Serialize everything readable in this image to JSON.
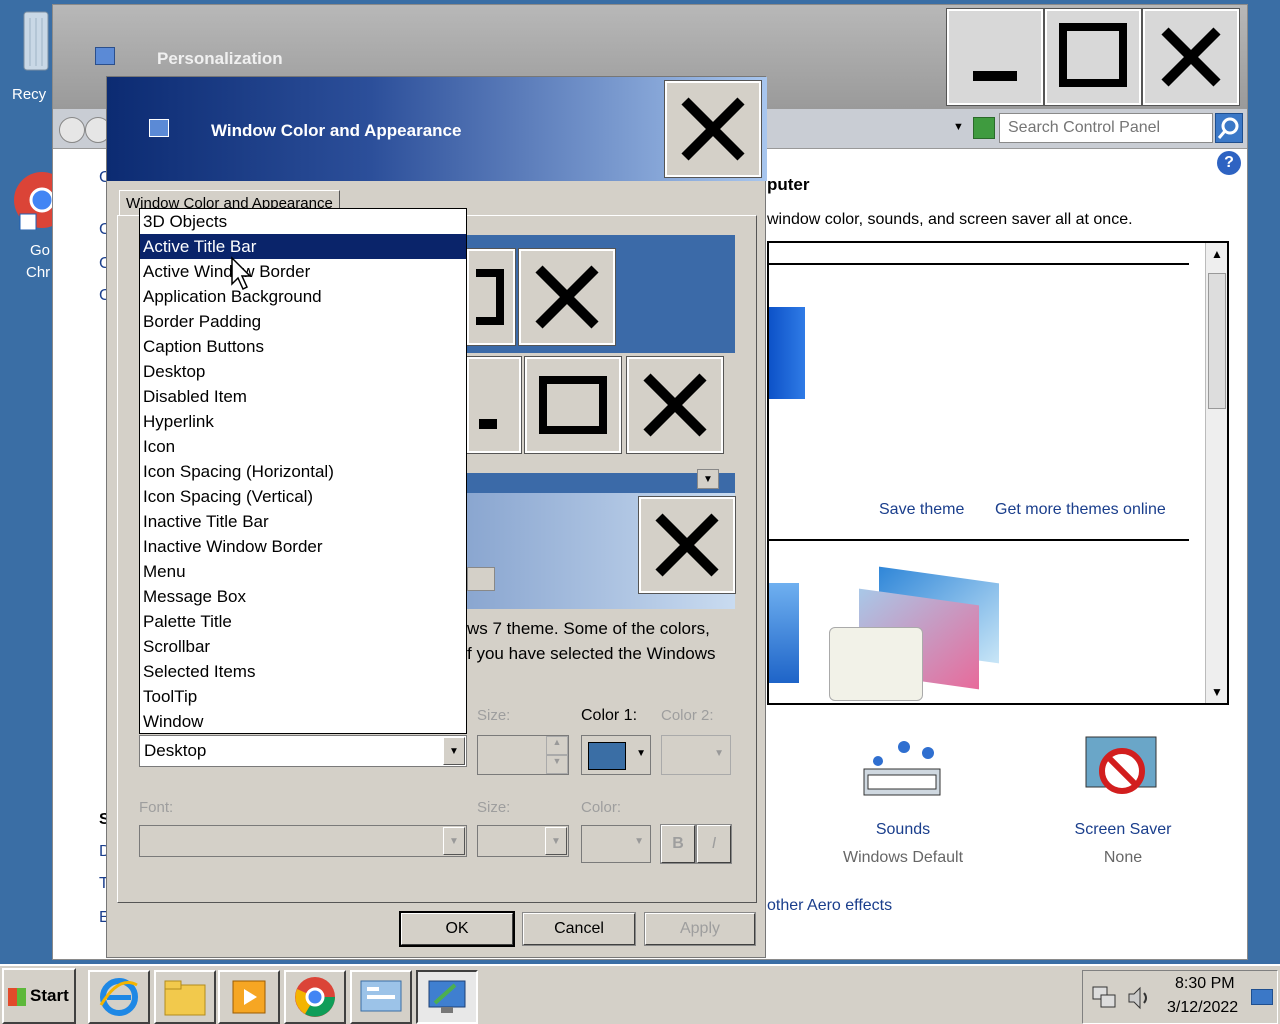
{
  "desktop": {
    "recycle_label": "Recy",
    "chrome_label_1": "Go",
    "chrome_label_2": "Chr"
  },
  "bg_window": {
    "title": "Personalization",
    "search_placeholder": "Search Control Panel",
    "help": "?",
    "heading_fragment": "puter",
    "desc_fragment": "window color, sounds, and screen saver all at once.",
    "save_theme": "Save theme",
    "get_more_themes": "Get more themes online",
    "sounds_label": "Sounds",
    "sounds_value": "Windows Default",
    "screensaver_label": "Screen Saver",
    "screensaver_value": "None",
    "aero_link": "other Aero effects",
    "left_fragments": [
      "C",
      "C",
      "C",
      "C",
      "S",
      "D",
      "T",
      "E"
    ]
  },
  "dialog": {
    "title": "Window Color and Appearance",
    "tab_label": "Window Color and Appearance",
    "info_line_1": "ws 7 theme.  Some of the colors,",
    "info_line_2": "f you have selected the Windows",
    "item_size_label": "Size:",
    "color1_label": "Color 1:",
    "color2_label": "Color 2:",
    "item_value": "Desktop",
    "font_label": "Font:",
    "font_size_label": "Size:",
    "font_color_label": "Color:",
    "bold_label": "B",
    "italic_label": "I",
    "ok": "OK",
    "cancel": "Cancel",
    "apply": "Apply",
    "color1_value": "#3a6ea5"
  },
  "listbox": {
    "items": [
      "3D Objects",
      "Active Title Bar",
      "Active Window Border",
      "Application Background",
      "Border Padding",
      "Caption Buttons",
      "Desktop",
      "Disabled Item",
      "Hyperlink",
      "Icon",
      "Icon Spacing (Horizontal)",
      "Icon Spacing (Vertical)",
      "Inactive Title Bar",
      "Inactive Window Border",
      "Menu",
      "Message Box",
      "Palette Title",
      "Scrollbar",
      "Selected Items",
      "ToolTip",
      "Window"
    ],
    "selected": "Active Title Bar"
  },
  "taskbar": {
    "start": "Start",
    "time": "8:30 PM",
    "date": "3/12/2022",
    "apps": [
      "internet-explorer-icon",
      "file-explorer-icon",
      "media-player-icon",
      "chrome-icon",
      "control-panel-icon",
      "personalization-icon"
    ]
  }
}
